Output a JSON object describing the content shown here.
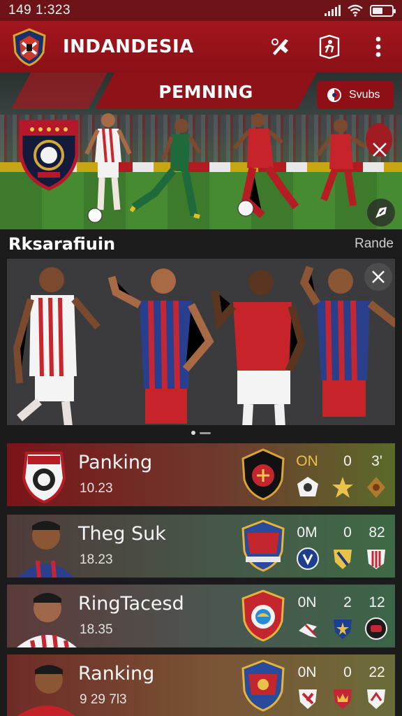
{
  "status_bar": {
    "time": "149 1:323"
  },
  "app_bar": {
    "title": "INDANDESIA"
  },
  "hero": {
    "banner_title": "PEMNING",
    "pill_label": "Svubs"
  },
  "section": {
    "title": "Rksarafiuin",
    "link": "Rande"
  },
  "list": [
    {
      "name": "Panking",
      "sub": "10.23",
      "stat1": "ON",
      "stat2": "0",
      "stat3": "3'"
    },
    {
      "name": "Theg Suk",
      "sub": "18.23",
      "stat1": "0M",
      "stat2": "0",
      "stat3": "82"
    },
    {
      "name": "RingTacesd",
      "sub": "18.35",
      "stat1": "0N",
      "stat2": "2",
      "stat3": "12"
    },
    {
      "name": "Ranking",
      "sub": "9 29 7l3",
      "stat1": "0N",
      "stat2": "0",
      "stat3": "22"
    }
  ],
  "colors": {
    "brand": "#a3161d",
    "accent_gold": "#e8c24a",
    "background": "#1b1b1b"
  }
}
